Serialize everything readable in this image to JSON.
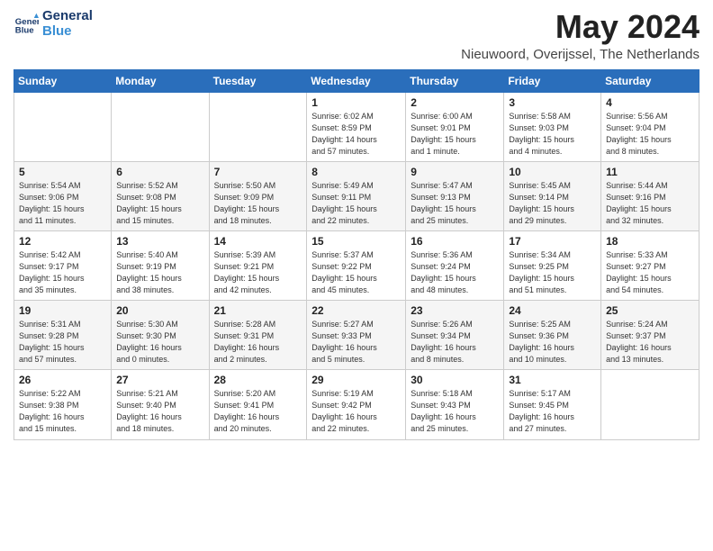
{
  "header": {
    "logo_line1": "General",
    "logo_line2": "Blue",
    "month_title": "May 2024",
    "location": "Nieuwoord, Overijssel, The Netherlands"
  },
  "weekdays": [
    "Sunday",
    "Monday",
    "Tuesday",
    "Wednesday",
    "Thursday",
    "Friday",
    "Saturday"
  ],
  "weeks": [
    [
      {
        "day": "",
        "info": ""
      },
      {
        "day": "",
        "info": ""
      },
      {
        "day": "",
        "info": ""
      },
      {
        "day": "1",
        "info": "Sunrise: 6:02 AM\nSunset: 8:59 PM\nDaylight: 14 hours\nand 57 minutes."
      },
      {
        "day": "2",
        "info": "Sunrise: 6:00 AM\nSunset: 9:01 PM\nDaylight: 15 hours\nand 1 minute."
      },
      {
        "day": "3",
        "info": "Sunrise: 5:58 AM\nSunset: 9:03 PM\nDaylight: 15 hours\nand 4 minutes."
      },
      {
        "day": "4",
        "info": "Sunrise: 5:56 AM\nSunset: 9:04 PM\nDaylight: 15 hours\nand 8 minutes."
      }
    ],
    [
      {
        "day": "5",
        "info": "Sunrise: 5:54 AM\nSunset: 9:06 PM\nDaylight: 15 hours\nand 11 minutes."
      },
      {
        "day": "6",
        "info": "Sunrise: 5:52 AM\nSunset: 9:08 PM\nDaylight: 15 hours\nand 15 minutes."
      },
      {
        "day": "7",
        "info": "Sunrise: 5:50 AM\nSunset: 9:09 PM\nDaylight: 15 hours\nand 18 minutes."
      },
      {
        "day": "8",
        "info": "Sunrise: 5:49 AM\nSunset: 9:11 PM\nDaylight: 15 hours\nand 22 minutes."
      },
      {
        "day": "9",
        "info": "Sunrise: 5:47 AM\nSunset: 9:13 PM\nDaylight: 15 hours\nand 25 minutes."
      },
      {
        "day": "10",
        "info": "Sunrise: 5:45 AM\nSunset: 9:14 PM\nDaylight: 15 hours\nand 29 minutes."
      },
      {
        "day": "11",
        "info": "Sunrise: 5:44 AM\nSunset: 9:16 PM\nDaylight: 15 hours\nand 32 minutes."
      }
    ],
    [
      {
        "day": "12",
        "info": "Sunrise: 5:42 AM\nSunset: 9:17 PM\nDaylight: 15 hours\nand 35 minutes."
      },
      {
        "day": "13",
        "info": "Sunrise: 5:40 AM\nSunset: 9:19 PM\nDaylight: 15 hours\nand 38 minutes."
      },
      {
        "day": "14",
        "info": "Sunrise: 5:39 AM\nSunset: 9:21 PM\nDaylight: 15 hours\nand 42 minutes."
      },
      {
        "day": "15",
        "info": "Sunrise: 5:37 AM\nSunset: 9:22 PM\nDaylight: 15 hours\nand 45 minutes."
      },
      {
        "day": "16",
        "info": "Sunrise: 5:36 AM\nSunset: 9:24 PM\nDaylight: 15 hours\nand 48 minutes."
      },
      {
        "day": "17",
        "info": "Sunrise: 5:34 AM\nSunset: 9:25 PM\nDaylight: 15 hours\nand 51 minutes."
      },
      {
        "day": "18",
        "info": "Sunrise: 5:33 AM\nSunset: 9:27 PM\nDaylight: 15 hours\nand 54 minutes."
      }
    ],
    [
      {
        "day": "19",
        "info": "Sunrise: 5:31 AM\nSunset: 9:28 PM\nDaylight: 15 hours\nand 57 minutes."
      },
      {
        "day": "20",
        "info": "Sunrise: 5:30 AM\nSunset: 9:30 PM\nDaylight: 16 hours\nand 0 minutes."
      },
      {
        "day": "21",
        "info": "Sunrise: 5:28 AM\nSunset: 9:31 PM\nDaylight: 16 hours\nand 2 minutes."
      },
      {
        "day": "22",
        "info": "Sunrise: 5:27 AM\nSunset: 9:33 PM\nDaylight: 16 hours\nand 5 minutes."
      },
      {
        "day": "23",
        "info": "Sunrise: 5:26 AM\nSunset: 9:34 PM\nDaylight: 16 hours\nand 8 minutes."
      },
      {
        "day": "24",
        "info": "Sunrise: 5:25 AM\nSunset: 9:36 PM\nDaylight: 16 hours\nand 10 minutes."
      },
      {
        "day": "25",
        "info": "Sunrise: 5:24 AM\nSunset: 9:37 PM\nDaylight: 16 hours\nand 13 minutes."
      }
    ],
    [
      {
        "day": "26",
        "info": "Sunrise: 5:22 AM\nSunset: 9:38 PM\nDaylight: 16 hours\nand 15 minutes."
      },
      {
        "day": "27",
        "info": "Sunrise: 5:21 AM\nSunset: 9:40 PM\nDaylight: 16 hours\nand 18 minutes."
      },
      {
        "day": "28",
        "info": "Sunrise: 5:20 AM\nSunset: 9:41 PM\nDaylight: 16 hours\nand 20 minutes."
      },
      {
        "day": "29",
        "info": "Sunrise: 5:19 AM\nSunset: 9:42 PM\nDaylight: 16 hours\nand 22 minutes."
      },
      {
        "day": "30",
        "info": "Sunrise: 5:18 AM\nSunset: 9:43 PM\nDaylight: 16 hours\nand 25 minutes."
      },
      {
        "day": "31",
        "info": "Sunrise: 5:17 AM\nSunset: 9:45 PM\nDaylight: 16 hours\nand 27 minutes."
      },
      {
        "day": "",
        "info": ""
      }
    ]
  ]
}
